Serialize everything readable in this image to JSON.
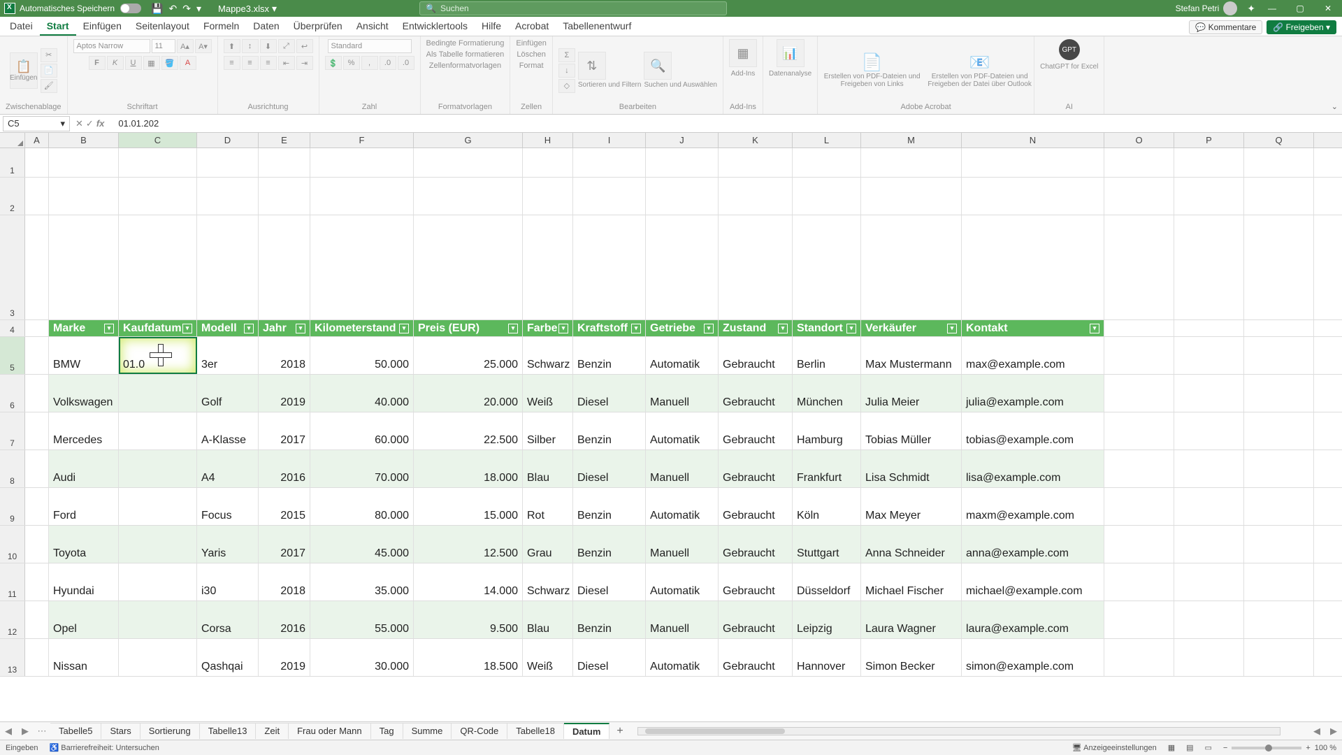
{
  "titlebar": {
    "autosave": "Automatisches Speichern",
    "filename": "Mappe3.xlsx",
    "search_placeholder": "Suchen",
    "user": "Stefan Petri"
  },
  "tabs": {
    "items": [
      "Datei",
      "Start",
      "Einfügen",
      "Seitenlayout",
      "Formeln",
      "Daten",
      "Überprüfen",
      "Ansicht",
      "Entwicklertools",
      "Hilfe",
      "Acrobat",
      "Tabellenentwurf"
    ],
    "active": 1,
    "comments": "Kommentare",
    "share": "Freigeben"
  },
  "ribbon": {
    "clipboard": {
      "paste": "Einfügen",
      "label": "Zwischenablage"
    },
    "font": {
      "name": "Aptos Narrow",
      "size": "11",
      "label": "Schriftart"
    },
    "align": {
      "label": "Ausrichtung"
    },
    "number": {
      "style": "Standard",
      "label": "Zahl"
    },
    "styles": {
      "a": "Bedingte Formatierung",
      "b": "Als Tabelle formatieren",
      "c": "Zellenformatvorlagen",
      "label": "Formatvorlagen"
    },
    "cells": {
      "a": "Einfügen",
      "b": "Löschen",
      "c": "Format",
      "label": "Zellen"
    },
    "editing": {
      "a": "Sortieren und Filtern",
      "b": "Suchen und Auswählen",
      "label": "Bearbeiten"
    },
    "addins": {
      "a": "Add-Ins",
      "label": "Add-Ins"
    },
    "analysis": {
      "a": "Datenanalyse"
    },
    "acrobat": {
      "a": "Erstellen von PDF-Dateien und Freigeben von Links",
      "b": "Erstellen von PDF-Dateien und Freigeben der Datei über Outlook",
      "label": "Adobe Acrobat"
    },
    "gpt": {
      "a": "ChatGPT for Excel",
      "label": "AI"
    }
  },
  "fbar": {
    "cellref": "C5",
    "formula": "01.01.202"
  },
  "columns": [
    "A",
    "B",
    "C",
    "D",
    "E",
    "F",
    "G",
    "H",
    "I",
    "J",
    "K",
    "L",
    "M",
    "N",
    "O",
    "P",
    "Q"
  ],
  "row_numbers": [
    "1",
    "2",
    "3",
    "4",
    "5",
    "6",
    "7",
    "8",
    "9",
    "10",
    "11",
    "12",
    "13"
  ],
  "headers": [
    "Marke",
    "Kaufdatum",
    "Modell",
    "Jahr",
    "Kilometerstand",
    "Preis (EUR)",
    "Farbe",
    "Kraftstoff",
    "Getriebe",
    "Zustand",
    "Standort",
    "Verkäufer",
    "Kontakt"
  ],
  "table": [
    {
      "marke": "BMW",
      "kauf": "01.0",
      "modell": "3er",
      "jahr": "2018",
      "km": "50.000",
      "preis": "25.000",
      "farbe": "Schwarz",
      "kraft": "Benzin",
      "getr": "Automatik",
      "zust": "Gebraucht",
      "ort": "Berlin",
      "verk": "Max Mustermann",
      "kontakt": "max@example.com"
    },
    {
      "marke": "Volkswagen",
      "kauf": "",
      "modell": "Golf",
      "jahr": "2019",
      "km": "40.000",
      "preis": "20.000",
      "farbe": "Weiß",
      "kraft": "Diesel",
      "getr": "Manuell",
      "zust": "Gebraucht",
      "ort": "München",
      "verk": "Julia Meier",
      "kontakt": "julia@example.com"
    },
    {
      "marke": "Mercedes",
      "kauf": "",
      "modell": "A-Klasse",
      "jahr": "2017",
      "km": "60.000",
      "preis": "22.500",
      "farbe": "Silber",
      "kraft": "Benzin",
      "getr": "Automatik",
      "zust": "Gebraucht",
      "ort": "Hamburg",
      "verk": "Tobias Müller",
      "kontakt": "tobias@example.com"
    },
    {
      "marke": "Audi",
      "kauf": "",
      "modell": "A4",
      "jahr": "2016",
      "km": "70.000",
      "preis": "18.000",
      "farbe": "Blau",
      "kraft": "Diesel",
      "getr": "Manuell",
      "zust": "Gebraucht",
      "ort": "Frankfurt",
      "verk": "Lisa Schmidt",
      "kontakt": "lisa@example.com"
    },
    {
      "marke": "Ford",
      "kauf": "",
      "modell": "Focus",
      "jahr": "2015",
      "km": "80.000",
      "preis": "15.000",
      "farbe": "Rot",
      "kraft": "Benzin",
      "getr": "Automatik",
      "zust": "Gebraucht",
      "ort": "Köln",
      "verk": "Max Meyer",
      "kontakt": "maxm@example.com"
    },
    {
      "marke": "Toyota",
      "kauf": "",
      "modell": "Yaris",
      "jahr": "2017",
      "km": "45.000",
      "preis": "12.500",
      "farbe": "Grau",
      "kraft": "Benzin",
      "getr": "Manuell",
      "zust": "Gebraucht",
      "ort": "Stuttgart",
      "verk": "Anna Schneider",
      "kontakt": "anna@example.com"
    },
    {
      "marke": "Hyundai",
      "kauf": "",
      "modell": "i30",
      "jahr": "2018",
      "km": "35.000",
      "preis": "14.000",
      "farbe": "Schwarz",
      "kraft": "Diesel",
      "getr": "Automatik",
      "zust": "Gebraucht",
      "ort": "Düsseldorf",
      "verk": "Michael Fischer",
      "kontakt": "michael@example.com"
    },
    {
      "marke": "Opel",
      "kauf": "",
      "modell": "Corsa",
      "jahr": "2016",
      "km": "55.000",
      "preis": "9.500",
      "farbe": "Blau",
      "kraft": "Benzin",
      "getr": "Manuell",
      "zust": "Gebraucht",
      "ort": "Leipzig",
      "verk": "Laura Wagner",
      "kontakt": "laura@example.com"
    },
    {
      "marke": "Nissan",
      "kauf": "",
      "modell": "Qashqai",
      "jahr": "2019",
      "km": "30.000",
      "preis": "18.500",
      "farbe": "Weiß",
      "kraft": "Diesel",
      "getr": "Automatik",
      "zust": "Gebraucht",
      "ort": "Hannover",
      "verk": "Simon Becker",
      "kontakt": "simon@example.com"
    }
  ],
  "sheets": {
    "items": [
      "Tabelle5",
      "Stars",
      "Sortierung",
      "Tabelle13",
      "Zeit",
      "Frau oder Mann",
      "Tag",
      "Summe",
      "QR-Code",
      "Tabelle18",
      "Datum"
    ],
    "active": 10
  },
  "status": {
    "mode": "Eingeben",
    "access": "Barrierefreiheit: Untersuchen",
    "display": "Anzeigeeinstellungen",
    "zoom": "100 %"
  }
}
